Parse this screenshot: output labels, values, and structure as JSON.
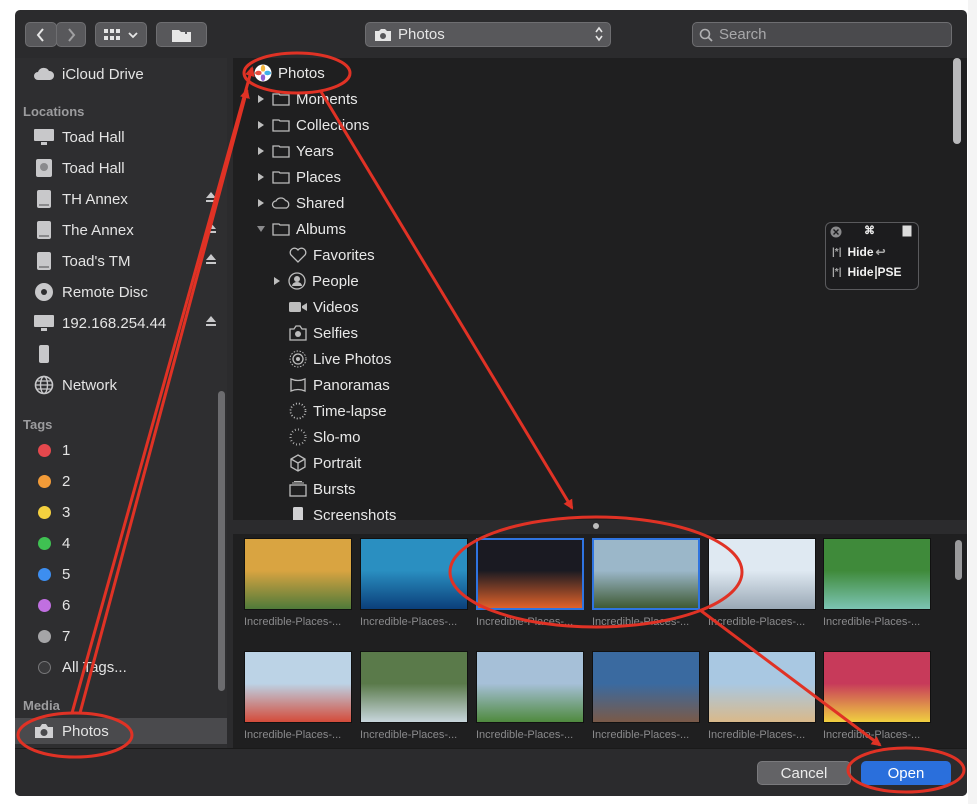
{
  "popup": {
    "label": "Photos"
  },
  "search": {
    "placeholder": "Search"
  },
  "sidebar": {
    "top_items": [
      {
        "label": "iCloud Drive",
        "icon": "cloud-icon"
      }
    ],
    "locations_header": "Locations",
    "locations": [
      {
        "label": "Toad Hall",
        "icon": "monitor-icon",
        "eject": false
      },
      {
        "label": "Toad Hall",
        "icon": "harddisk-icon",
        "eject": false
      },
      {
        "label": "TH Annex",
        "icon": "drive-icon",
        "eject": true
      },
      {
        "label": "The Annex",
        "icon": "drive-icon",
        "eject": true
      },
      {
        "label": "Toad's TM",
        "icon": "drive-icon",
        "eject": true
      },
      {
        "label": "Remote Disc",
        "icon": "disc-icon",
        "eject": false
      },
      {
        "label": "192.168.254.44",
        "icon": "monitor-icon",
        "eject": true
      },
      {
        "label": "",
        "icon": "phone-icon",
        "eject": false
      },
      {
        "label": "Network",
        "icon": "globe-icon",
        "eject": false
      }
    ],
    "tags_header": "Tags",
    "tags": [
      {
        "label": "1",
        "color": "#e5484d"
      },
      {
        "label": "2",
        "color": "#f29b38"
      },
      {
        "label": "3",
        "color": "#f4d03f"
      },
      {
        "label": "4",
        "color": "#3fc152"
      },
      {
        "label": "5",
        "color": "#3d8ef0"
      },
      {
        "label": "6",
        "color": "#c06fe0"
      },
      {
        "label": "7",
        "color": "#a5a5a7"
      },
      {
        "label": "All Tags...",
        "color": "#777779"
      }
    ],
    "media_header": "Media",
    "media": [
      {
        "label": "Photos",
        "icon": "camera-icon"
      }
    ]
  },
  "tree": {
    "root": "Photos",
    "items": [
      {
        "label": "Moments",
        "level": 1,
        "expander": "collapsed",
        "icon": "folder-icon"
      },
      {
        "label": "Collections",
        "level": 1,
        "expander": "collapsed",
        "icon": "folder-icon"
      },
      {
        "label": "Years",
        "level": 1,
        "expander": "collapsed",
        "icon": "folder-icon"
      },
      {
        "label": "Places",
        "level": 1,
        "expander": "collapsed",
        "icon": "folder-icon"
      },
      {
        "label": "Shared",
        "level": 1,
        "expander": "collapsed",
        "icon": "cloud-icon"
      },
      {
        "label": "Albums",
        "level": 1,
        "expander": "expanded",
        "icon": "folder-icon"
      },
      {
        "label": "Favorites",
        "level": 2,
        "expander": "none",
        "icon": "heart-icon"
      },
      {
        "label": "People",
        "level": 2,
        "expander": "collapsed",
        "icon": "person-icon"
      },
      {
        "label": "Videos",
        "level": 2,
        "expander": "none",
        "icon": "video-icon"
      },
      {
        "label": "Selfies",
        "level": 2,
        "expander": "none",
        "icon": "selfie-icon"
      },
      {
        "label": "Live Photos",
        "level": 2,
        "expander": "none",
        "icon": "live-photo-icon"
      },
      {
        "label": "Panoramas",
        "level": 2,
        "expander": "none",
        "icon": "panorama-icon"
      },
      {
        "label": "Time-lapse",
        "level": 2,
        "expander": "none",
        "icon": "timelapse-icon"
      },
      {
        "label": "Slo-mo",
        "level": 2,
        "expander": "none",
        "icon": "slomo-icon"
      },
      {
        "label": "Portrait",
        "level": 2,
        "expander": "none",
        "icon": "cube-icon"
      },
      {
        "label": "Bursts",
        "level": 2,
        "expander": "none",
        "icon": "bursts-icon"
      },
      {
        "label": "Screenshots",
        "level": 2,
        "expander": "none",
        "icon": "screenshot-icon"
      }
    ]
  },
  "overlay": {
    "hide1": "Hide",
    "hide2": "Hide",
    "pse": "PSE",
    "cmd": "⌘"
  },
  "thumbnails": [
    {
      "caption": "Incredible-Places-...",
      "c1": "#d9a441",
      "c2": "#4f7a3a",
      "selected": false
    },
    {
      "caption": "Incredible-Places-...",
      "c1": "#2a8fc1",
      "c2": "#0b3f7a",
      "selected": false
    },
    {
      "caption": "Incredible-Places-...",
      "c1": "#1a1a22",
      "c2": "#e0622a",
      "selected": true
    },
    {
      "caption": "Incredible-Places-...",
      "c1": "#9bb7c9",
      "c2": "#3f5a34",
      "selected": true
    },
    {
      "caption": "Incredible-Places-...",
      "c1": "#dfe9f2",
      "c2": "#9aa8b5",
      "selected": false
    },
    {
      "caption": "Incredible-Places-...",
      "c1": "#3f8a3a",
      "c2": "#7cc4b3",
      "selected": false
    },
    {
      "caption": "Incredible-Places-...",
      "c1": "#bcd3e6",
      "c2": "#d44b3a",
      "selected": false
    },
    {
      "caption": "Incredible-Places-...",
      "c1": "#5a7a4a",
      "c2": "#c8d6dc",
      "selected": false
    },
    {
      "caption": "Incredible-Places-...",
      "c1": "#a6c0d8",
      "c2": "#4f8a3e",
      "selected": false
    },
    {
      "caption": "Incredible-Places-...",
      "c1": "#3a6aa0",
      "c2": "#7a5a48",
      "selected": false
    },
    {
      "caption": "Incredible-Places-...",
      "c1": "#a9c8e2",
      "c2": "#d9b98a",
      "selected": false
    },
    {
      "caption": "Incredible-Places-...",
      "c1": "#c73a5a",
      "c2": "#f0d040",
      "selected": false
    }
  ],
  "footer": {
    "cancel": "Cancel",
    "open": "Open"
  },
  "colors": {
    "accent": "#2a6fdc",
    "annotation": "#e03225"
  }
}
